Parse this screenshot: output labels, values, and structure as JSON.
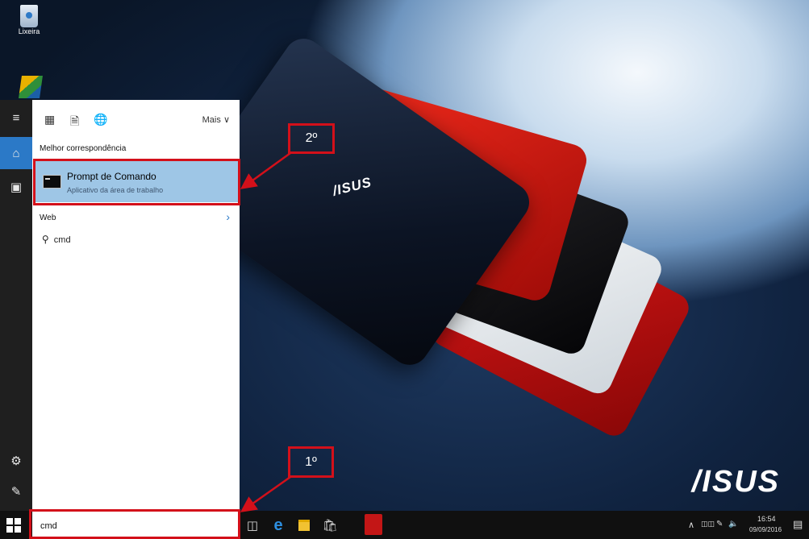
{
  "desktop": {
    "recycle_bin_label": "Lixeira",
    "laptop_logo": "/ISUS",
    "brand_logo": "/ISUS"
  },
  "start_rail": {
    "menu_icon": "hamburger-icon",
    "home_icon": "home-icon",
    "notebook_icon": "notebook-icon",
    "settings_icon": "gear-icon",
    "feedback_icon": "feedback-icon"
  },
  "search_panel": {
    "more_label": "Mais",
    "best_match_label": "Melhor correspondência",
    "best_match": {
      "title": "Prompt de Comando",
      "subtitle": "Aplicativo da área de trabalho"
    },
    "web_label": "Web",
    "web_suggestion": "cmd"
  },
  "annotations": {
    "step2": "2º",
    "step1": "1º",
    "color": "#d3101a"
  },
  "taskbar": {
    "search_value": "cmd",
    "clock_time": "16:54",
    "clock_date": "09/09/2016"
  },
  "colors": {
    "selection": "#9ec6e6",
    "accent": "#2b79c7",
    "rail": "#1f1f1f",
    "taskbar": "#101010"
  }
}
